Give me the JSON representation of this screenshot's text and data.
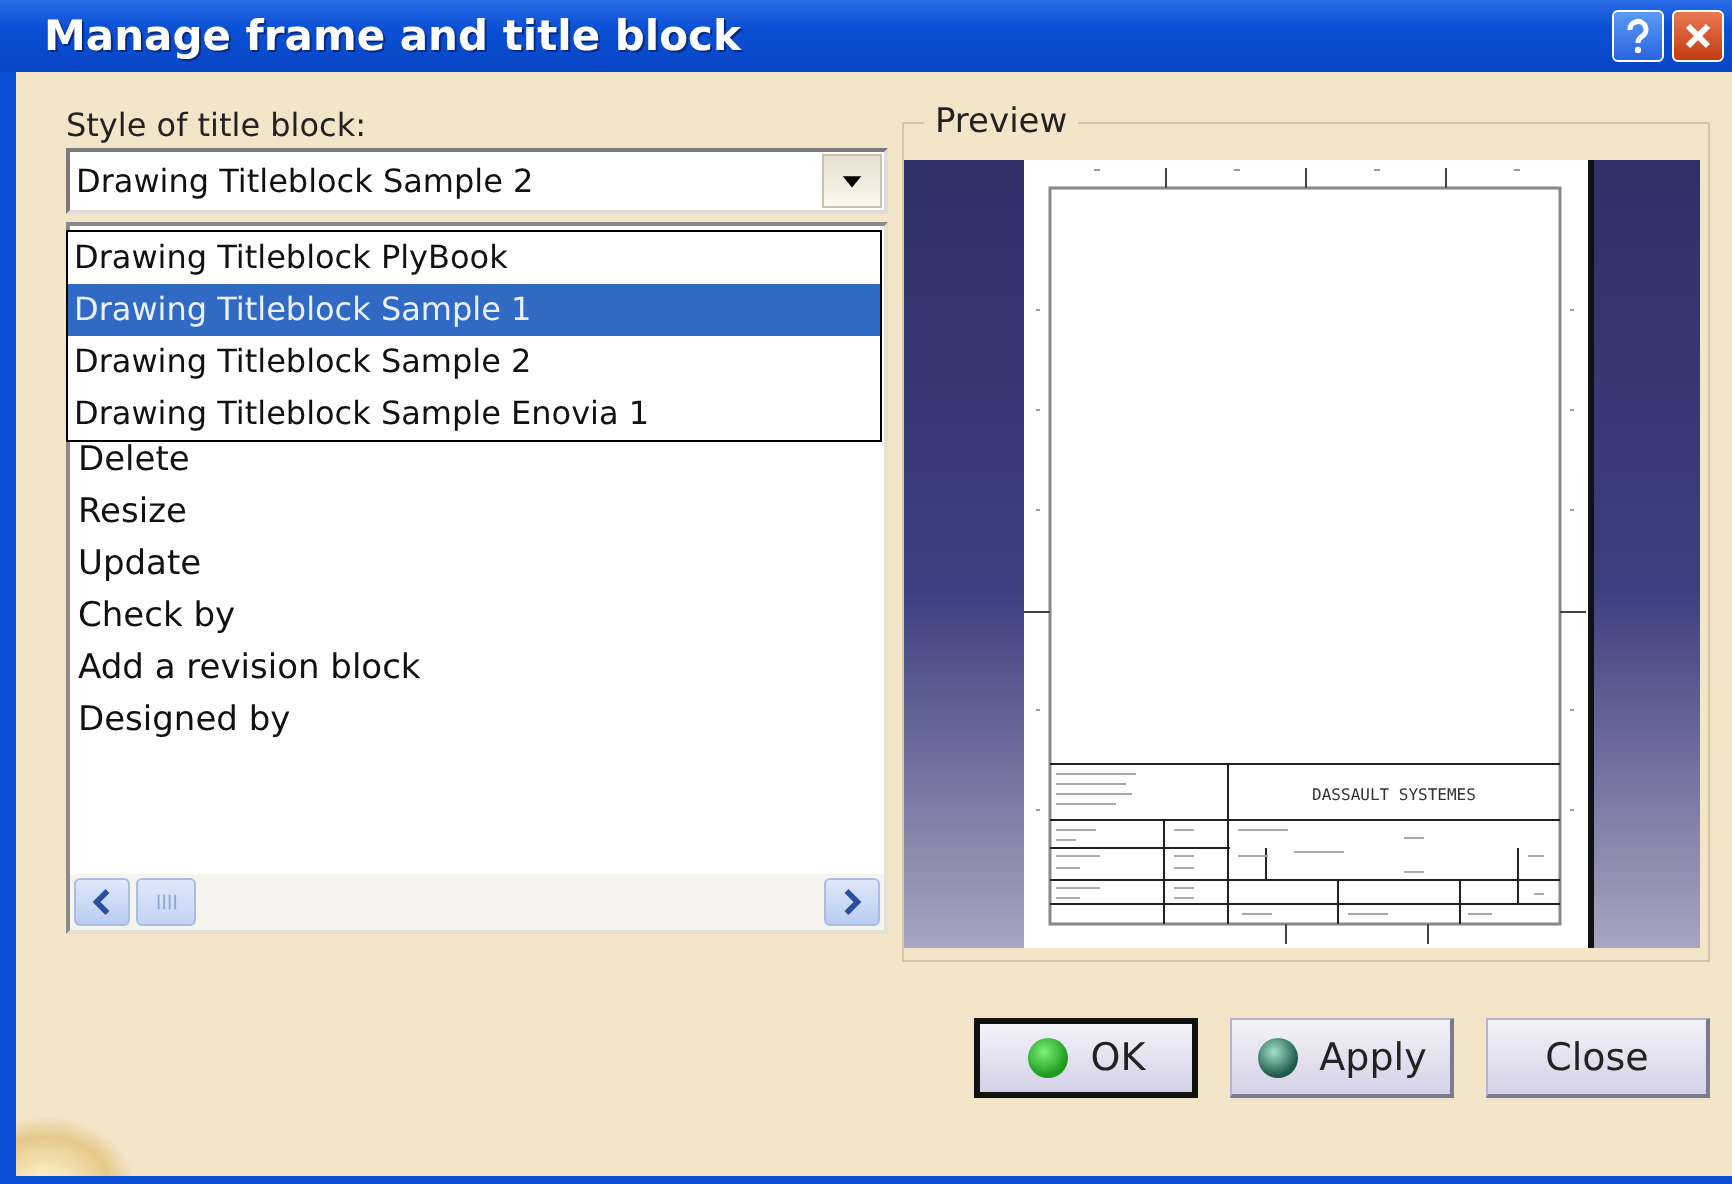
{
  "window": {
    "title": "Manage frame and title block"
  },
  "style_field": {
    "label": "Style of title block:",
    "value": "Drawing Titleblock Sample 2",
    "expanded": true
  },
  "style_options": [
    {
      "label": "Drawing Titleblock PlyBook",
      "selected": false
    },
    {
      "label": "Drawing Titleblock Sample 1",
      "selected": true
    },
    {
      "label": "Drawing Titleblock Sample 2",
      "selected": false
    },
    {
      "label": "Drawing Titleblock Sample Enovia 1",
      "selected": false
    }
  ],
  "actions": [
    "Delete",
    "Resize",
    "Update",
    "Check by",
    "Add a revision block",
    "Designed by"
  ],
  "preview": {
    "title": "Preview",
    "company": "DASSAULT SYSTEMES"
  },
  "buttons": [
    {
      "label": "OK",
      "kind": "ok",
      "default": true
    },
    {
      "label": "Apply",
      "kind": "apply",
      "default": false
    },
    {
      "label": "Close",
      "kind": "plain",
      "default": false
    }
  ]
}
